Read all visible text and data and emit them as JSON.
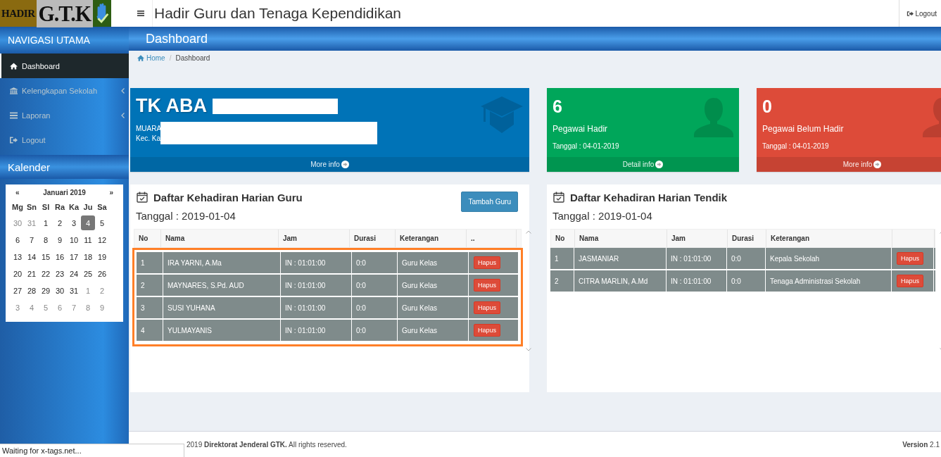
{
  "logo": {
    "left": "HADIR",
    "right": "G.T.K"
  },
  "header": {
    "title": "Hadir Guru dan Tenaga Kependidikan",
    "logout": "Logout"
  },
  "sidebar": {
    "heading": "NAVIGASI UTAMA",
    "items": [
      {
        "label": "Dashboard",
        "kind": "home",
        "selected": true,
        "expandable": false
      },
      {
        "label": "Kelengkapan Sekolah",
        "kind": "bank",
        "selected": false,
        "expandable": true
      },
      {
        "label": "Laporan",
        "kind": "list",
        "selected": false,
        "expandable": true
      },
      {
        "label": "Logout",
        "kind": "signout",
        "selected": false,
        "expandable": false
      }
    ],
    "calendar_heading": "Kalender"
  },
  "calendar": {
    "prev": "«",
    "month": "Januari 2019",
    "next": "»",
    "weekdays": [
      "Mg",
      "Sn",
      "Sl",
      "Ra",
      "Ka",
      "Ju",
      "Sa"
    ],
    "days": [
      {
        "label": "30",
        "muted": true,
        "selected": false
      },
      {
        "label": "31",
        "muted": true,
        "selected": false
      },
      {
        "label": "1",
        "muted": false,
        "selected": false
      },
      {
        "label": "2",
        "muted": false,
        "selected": false
      },
      {
        "label": "3",
        "muted": false,
        "selected": false
      },
      {
        "label": "4",
        "muted": false,
        "selected": true
      },
      {
        "label": "5",
        "muted": false,
        "selected": false
      },
      {
        "label": "6",
        "muted": false,
        "selected": false
      },
      {
        "label": "7",
        "muted": false,
        "selected": false
      },
      {
        "label": "8",
        "muted": false,
        "selected": false
      },
      {
        "label": "9",
        "muted": false,
        "selected": false
      },
      {
        "label": "10",
        "muted": false,
        "selected": false
      },
      {
        "label": "11",
        "muted": false,
        "selected": false
      },
      {
        "label": "12",
        "muted": false,
        "selected": false
      },
      {
        "label": "13",
        "muted": false,
        "selected": false
      },
      {
        "label": "14",
        "muted": false,
        "selected": false
      },
      {
        "label": "15",
        "muted": false,
        "selected": false
      },
      {
        "label": "16",
        "muted": false,
        "selected": false
      },
      {
        "label": "17",
        "muted": false,
        "selected": false
      },
      {
        "label": "18",
        "muted": false,
        "selected": false
      },
      {
        "label": "19",
        "muted": false,
        "selected": false
      },
      {
        "label": "20",
        "muted": false,
        "selected": false
      },
      {
        "label": "21",
        "muted": false,
        "selected": false
      },
      {
        "label": "22",
        "muted": false,
        "selected": false
      },
      {
        "label": "23",
        "muted": false,
        "selected": false
      },
      {
        "label": "24",
        "muted": false,
        "selected": false
      },
      {
        "label": "25",
        "muted": false,
        "selected": false
      },
      {
        "label": "26",
        "muted": false,
        "selected": false
      },
      {
        "label": "27",
        "muted": false,
        "selected": false
      },
      {
        "label": "28",
        "muted": false,
        "selected": false
      },
      {
        "label": "29",
        "muted": false,
        "selected": false
      },
      {
        "label": "30",
        "muted": false,
        "selected": false
      },
      {
        "label": "31",
        "muted": false,
        "selected": false
      },
      {
        "label": "1",
        "muted": true,
        "selected": false
      },
      {
        "label": "2",
        "muted": true,
        "selected": false
      },
      {
        "label": "3",
        "muted": true,
        "selected": false
      },
      {
        "label": "4",
        "muted": true,
        "selected": false
      },
      {
        "label": "5",
        "muted": true,
        "selected": false
      },
      {
        "label": "6",
        "muted": true,
        "selected": false
      },
      {
        "label": "7",
        "muted": true,
        "selected": false
      },
      {
        "label": "8",
        "muted": true,
        "selected": false
      },
      {
        "label": "9",
        "muted": true,
        "selected": false
      }
    ]
  },
  "page_title": "Dashboard",
  "breadcrumb": {
    "separator": "/",
    "items": [
      {
        "label": "Home"
      },
      {
        "label": "Dashboard"
      }
    ]
  },
  "cards": [
    {
      "kind": "school",
      "color": "#0073b7",
      "title": "TK ABA",
      "line_1": "MUARA",
      "line_2": "Kec. Ka",
      "footer": "More info"
    },
    {
      "kind": "stat",
      "color": "#00a65a",
      "value": "6",
      "label": "Pegawai Hadir",
      "date": "Tanggal : 04-01-2019",
      "footer": "Detail info"
    },
    {
      "kind": "stat",
      "color": "#dd4b39",
      "value": "0",
      "label": "Pegawai Belum Hadir",
      "date": "Tanggal : 04-01-2019",
      "footer": "More info"
    }
  ],
  "panels": [
    {
      "title": "Daftar Kehadiran Harian Guru",
      "add_button": "Tambah Guru",
      "date": "Tanggal : 2019-01-04",
      "highlighted": true,
      "columns": [
        "No",
        "Nama",
        "Jam",
        "Durasi",
        "Keterangan",
        ".."
      ],
      "rows": [
        {
          "no": "1",
          "nama": "IRA YARNI, A.Ma",
          "jam": "IN : 01:01:00",
          "durasi": "0:0",
          "keterangan": "Guru Kelas",
          "action": "Hapus"
        },
        {
          "no": "2",
          "nama": "MAYNARES, S.Pd. AUD",
          "jam": "IN : 01:01:00",
          "durasi": "0:0",
          "keterangan": "Guru Kelas",
          "action": "Hapus"
        },
        {
          "no": "3",
          "nama": "SUSI YUHANA",
          "jam": "IN : 01:01:00",
          "durasi": "0:0",
          "keterangan": "Guru Kelas",
          "action": "Hapus"
        },
        {
          "no": "4",
          "nama": "YULMAYANIS",
          "jam": "IN : 01:01:00",
          "durasi": "0:0",
          "keterangan": "Guru Kelas",
          "action": "Hapus"
        }
      ]
    },
    {
      "title": "Daftar Kehadiran Harian Tendik",
      "date": "Tanggal : 2019-01-04",
      "highlighted": false,
      "columns": [
        "No",
        "Nama",
        "Jam",
        "Durasi",
        "Keterangan"
      ],
      "rows": [
        {
          "no": "1",
          "nama": "JASMANIAR",
          "jam": "IN : 01:01:00",
          "durasi": "0:0",
          "keterangan": "Kepala Sekolah",
          "action": "Hapus"
        },
        {
          "no": "2",
          "nama": "CITRA MARLIN, A.Md",
          "jam": "IN : 01:01:00",
          "durasi": "0:0",
          "keterangan": "Tenaga Administrasi Sekolah",
          "action": "Hapus"
        }
      ]
    }
  ],
  "footer": {
    "copyright": "2019 **Direktorat Jenderal GTK.** All rights reserved.",
    "version_label": "Version",
    "version": "2.1"
  },
  "status_bar": "Waiting for x-tags.net..."
}
